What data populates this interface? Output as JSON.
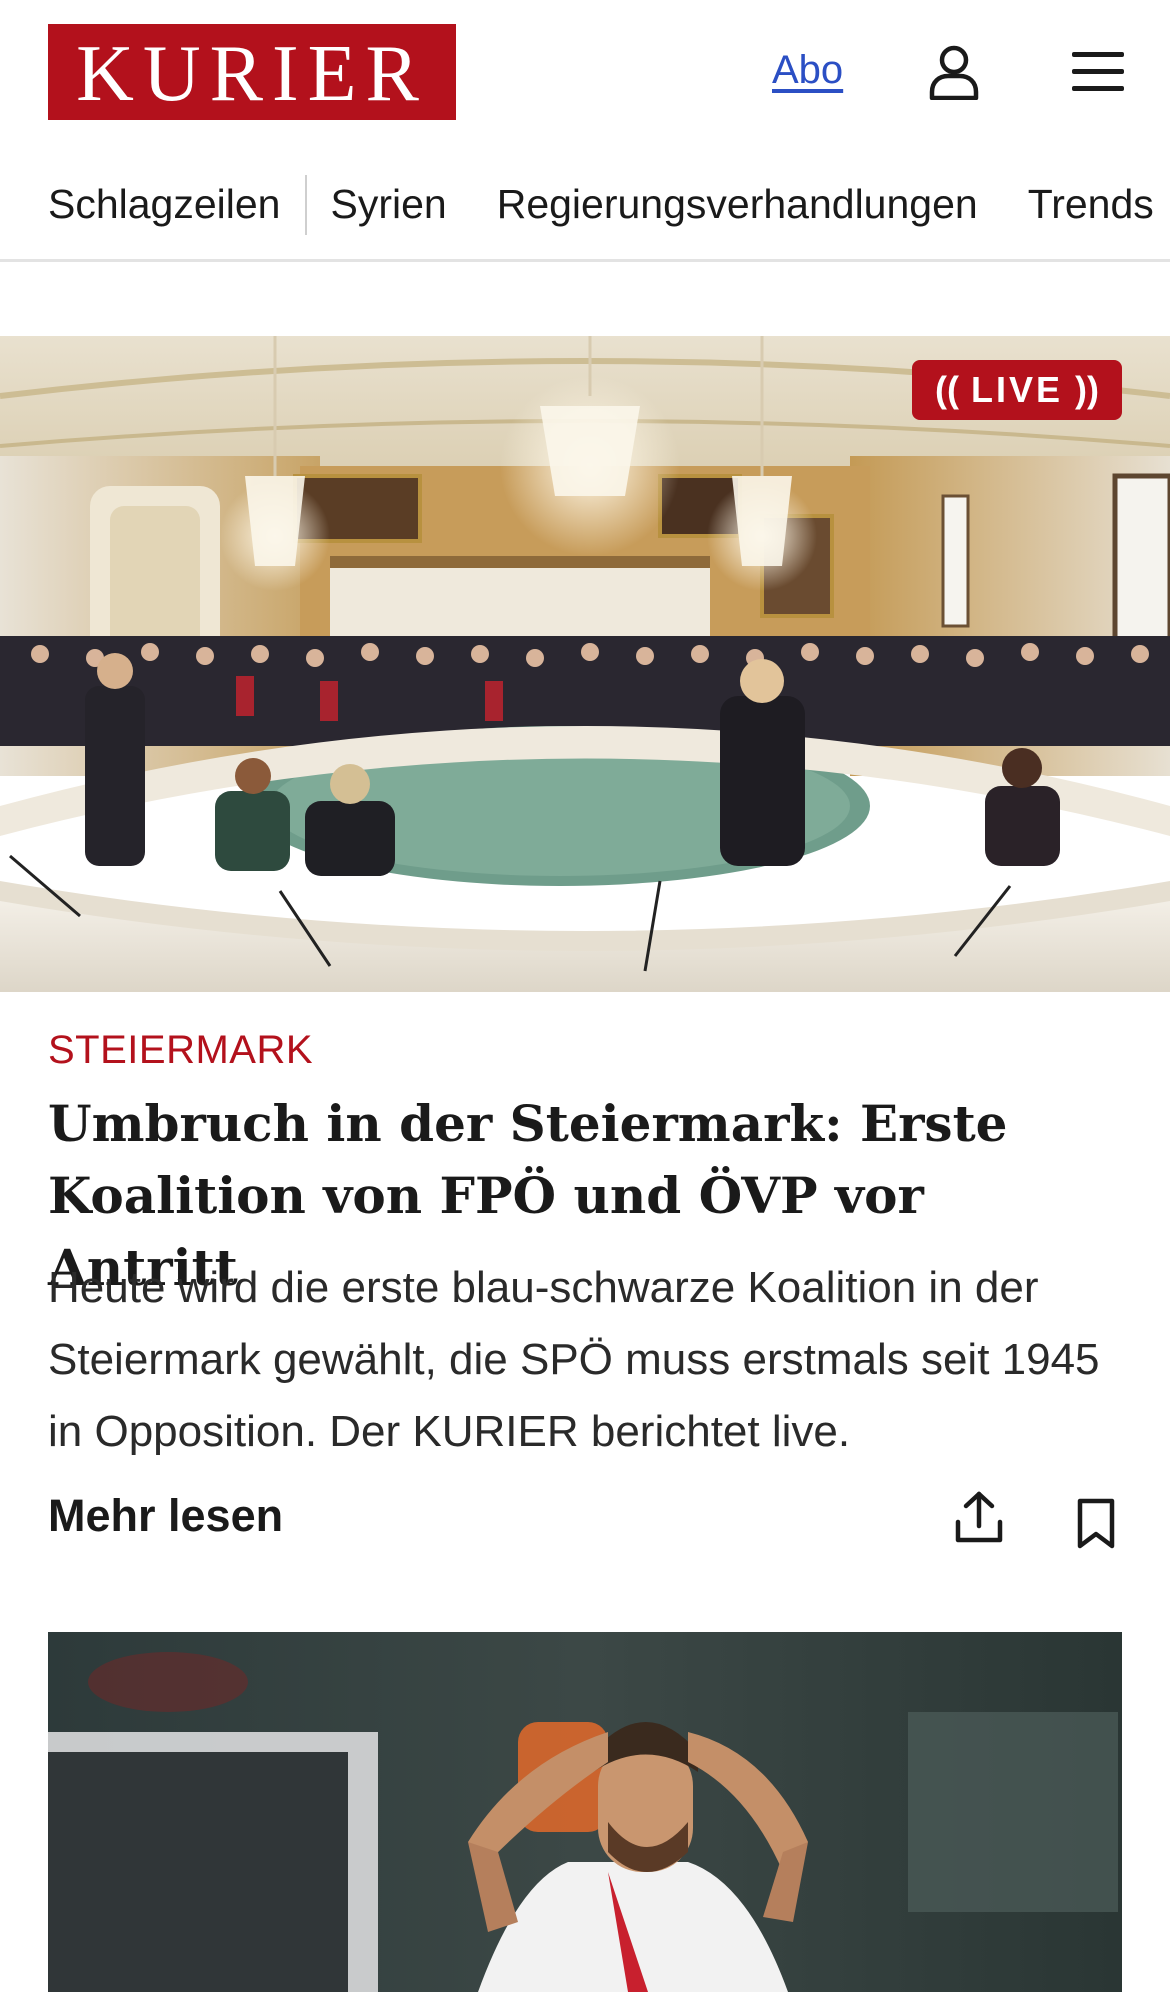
{
  "header": {
    "logo_text": "KURIER",
    "abo_label": "Abo",
    "icons": {
      "user": "user-icon",
      "menu": "menu-icon"
    }
  },
  "nav": {
    "items": [
      {
        "label": "Schlagzeilen"
      },
      {
        "label": "Syrien"
      },
      {
        "label": "Regierungsverhandlungen"
      },
      {
        "label": "Trends"
      }
    ]
  },
  "hero": {
    "badge_label": "LIVE"
  },
  "article": {
    "kicker": "STEIERMARK",
    "headline": "Umbruch in der Steiermark: Erste Koali­tion von FPÖ und ÖVP vor Antritt",
    "teaser": "Heute wird die erste blau-schwarze Koalition in der Steiermark gewählt, die SPÖ muss erstmals seit 1945 in Opposition. Der KURIER berichtet live.",
    "read_more": "Mehr lesen",
    "icons": {
      "share": "share-icon",
      "bookmark": "bookmark-icon"
    }
  },
  "colors": {
    "brand_red": "#b3111c",
    "link_blue": "#2b4fc4",
    "text": "#1a1a1a"
  }
}
